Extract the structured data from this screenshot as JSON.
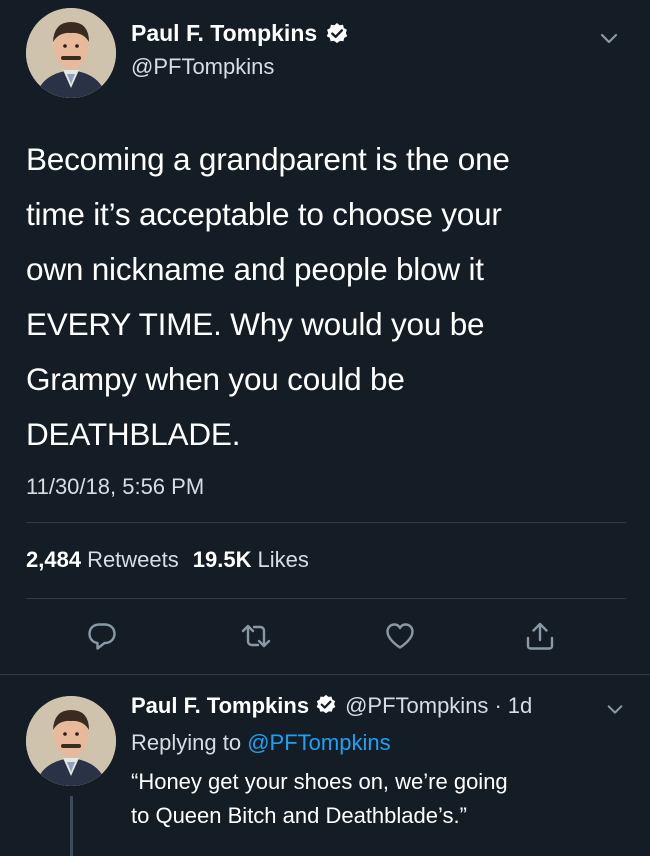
{
  "main_tweet": {
    "author_name": "Paul F. Tompkins",
    "handle": "@PFTompkins",
    "text": "Becoming a grandparent is the one\ntime it’s acceptable to choose your\nown nickname and people blow it\nEVERY TIME. Why would you be\nGrampy when you could be\nDEATHBLADE.",
    "timestamp": "11/30/18, 5:56 PM",
    "retweets_count": "2,484",
    "retweets_label": "Retweets",
    "likes_count": "19.5K",
    "likes_label": "Likes",
    "actions": [
      {
        "name": "reply",
        "icon": "reply-icon"
      },
      {
        "name": "retweet",
        "icon": "retweet-icon"
      },
      {
        "name": "like",
        "icon": "heart-icon"
      },
      {
        "name": "share",
        "icon": "share-icon"
      }
    ]
  },
  "reply_tweet": {
    "author_name": "Paul F. Tompkins",
    "handle": "@PFTompkins",
    "separator": "·",
    "time_ago": "1d",
    "replying_prefix": "Replying to",
    "replying_to": "@PFTompkins",
    "text": "“Honey get your shoes on, we’re going\nto Queen Bitch and Deathblade’s.”"
  },
  "colors": {
    "background": "#141d26",
    "text_primary": "#ffffff",
    "text_secondary": "#d7dde3",
    "link": "#1da1f2",
    "divider": "#2f3b47"
  }
}
